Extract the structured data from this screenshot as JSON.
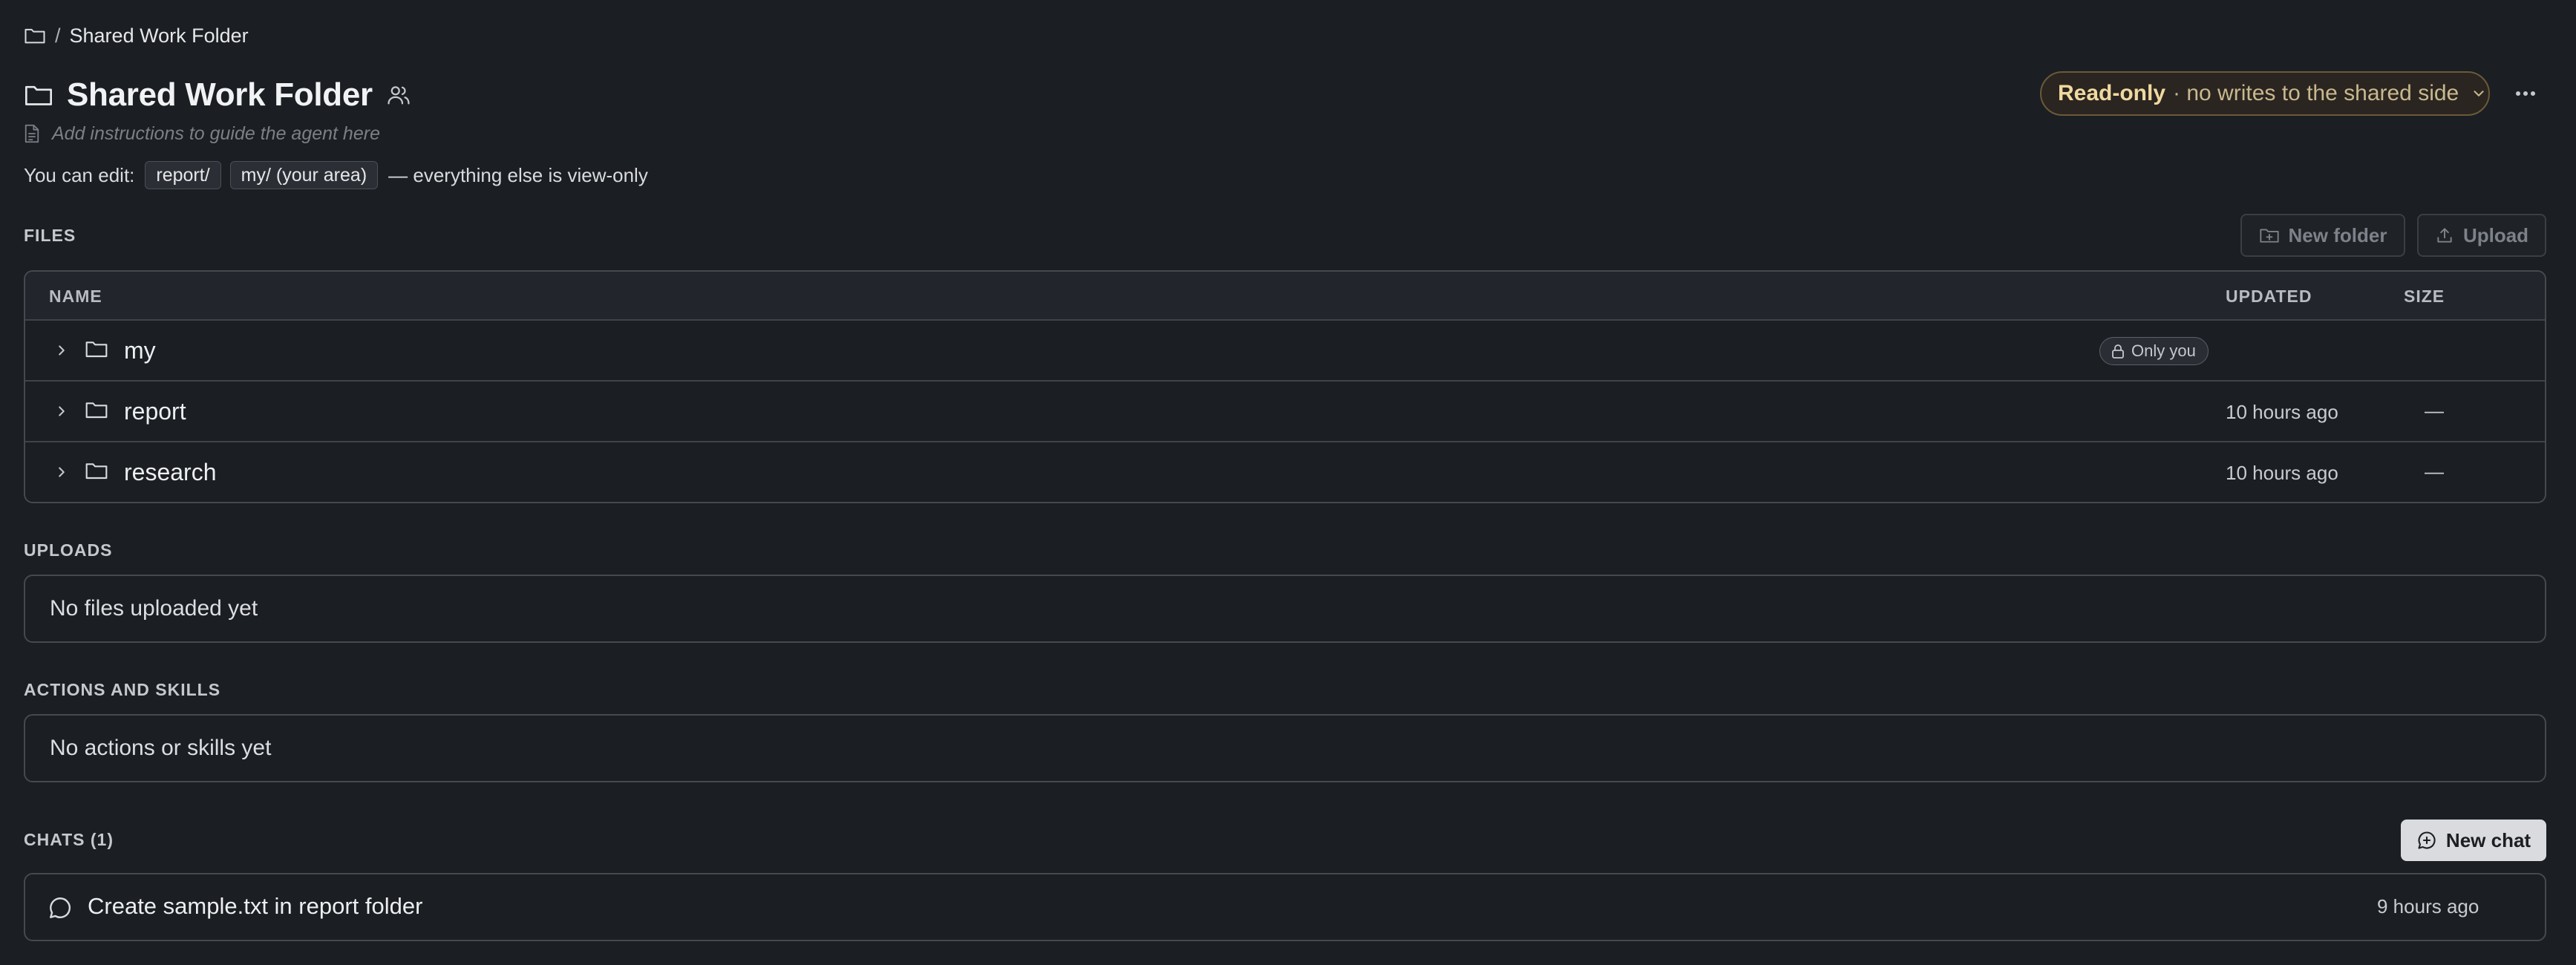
{
  "breadcrumb": {
    "separator": "/",
    "current": "Shared Work Folder"
  },
  "header": {
    "title": "Shared Work Folder",
    "instructions_placeholder": "Add instructions to guide the agent here"
  },
  "permissions": {
    "prefix": "You can edit:",
    "editable": [
      "report/",
      "my/ (your area)"
    ],
    "suffix": "— everything else is view-only"
  },
  "access": {
    "mode": "Read-only",
    "description": "· no writes to the shared side"
  },
  "files": {
    "section_label": "FILES",
    "new_folder_label": "New folder",
    "upload_label": "Upload",
    "columns": {
      "name": "NAME",
      "updated": "UPDATED",
      "size": "SIZE"
    },
    "rows": [
      {
        "name": "my",
        "badge": "Only you",
        "updated": "",
        "size": ""
      },
      {
        "name": "report",
        "badge": "",
        "updated": "10 hours ago",
        "size": "—"
      },
      {
        "name": "research",
        "badge": "",
        "updated": "10 hours ago",
        "size": "—"
      }
    ]
  },
  "uploads": {
    "section_label": "UPLOADS",
    "empty_text": "No files uploaded yet"
  },
  "actions": {
    "section_label": "ACTIONS AND SKILLS",
    "empty_text": "No actions or skills yet"
  },
  "chats": {
    "section_label": "CHATS (1)",
    "new_chat_label": "New chat",
    "items": [
      {
        "title": "Create sample.txt in report folder",
        "time": "9 hours ago"
      }
    ]
  },
  "icons": {
    "breadcrumb": "folder-icon",
    "title": "folder-icon",
    "shared": "users-icon",
    "instructions": "document-icon",
    "pill": "chevron-down-icon",
    "more": "more-horizontal-icon",
    "new_folder": "folder-plus-icon",
    "upload": "upload-icon",
    "row_expand": "chevron-right-icon",
    "lock": "lock-icon",
    "new_chat": "chat-plus-icon",
    "chat": "chat-bubble-icon"
  },
  "colors": {
    "background": "#1b1e22",
    "accent_readonly": "#f0d9a0",
    "readonly_border": "#6b5a38"
  }
}
